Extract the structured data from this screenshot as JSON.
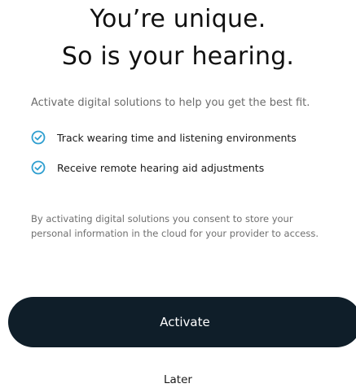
{
  "header": {
    "title_line1": "You’re unique.",
    "title_line2": "So is your hearing."
  },
  "intro_text": "Activate digital solutions to help you get the best fit.",
  "benefits": [
    {
      "icon": "check-circle-icon",
      "label": "Track wearing time and listening environments"
    },
    {
      "icon": "check-circle-icon",
      "label": "Receive remote hearing aid adjustments"
    }
  ],
  "consent_text": "By activating digital solutions you consent to store your personal information in the cloud for your provider to access.",
  "actions": {
    "primary_label": "Activate",
    "secondary_label": "Later"
  },
  "colors": {
    "accent": "#2f9fd0",
    "primary_button": "#0f1e29"
  }
}
